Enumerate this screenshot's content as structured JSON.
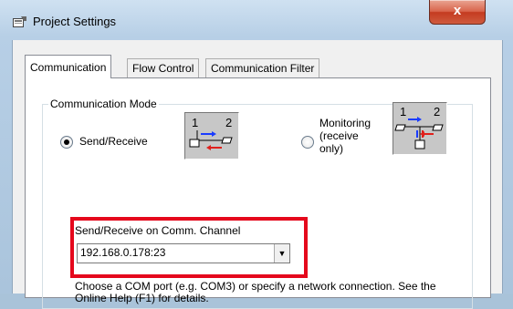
{
  "window": {
    "title": "Project Settings",
    "close_glyph": "x"
  },
  "tabs": [
    {
      "label": "Communication",
      "active": true
    },
    {
      "label": "Flow Control",
      "active": false
    },
    {
      "label": "Communication Filter",
      "active": false
    }
  ],
  "mode_group": {
    "legend": "Communication Mode",
    "send_receive": {
      "label": "Send/Receive",
      "selected": true,
      "icon": "send-receive-diagram-icon",
      "diagram_numbers": [
        "1",
        "2"
      ]
    },
    "monitoring": {
      "label_lines": [
        "Monitoring",
        "(receive",
        "only)"
      ],
      "selected": false,
      "icon": "monitoring-diagram-icon",
      "diagram_numbers": [
        "1",
        "2"
      ]
    }
  },
  "channel": {
    "label": "Send/Receive on Comm. Channel",
    "value": "192.168.0.178:23",
    "highlight_color": "#e5081c"
  },
  "help_text": "Choose a COM port (e.g. COM3) or specify a network connection. See the Online Help (F1) for details.",
  "colors": {
    "arrow_blue": "#1a3cff",
    "arrow_red": "#e0201c"
  }
}
